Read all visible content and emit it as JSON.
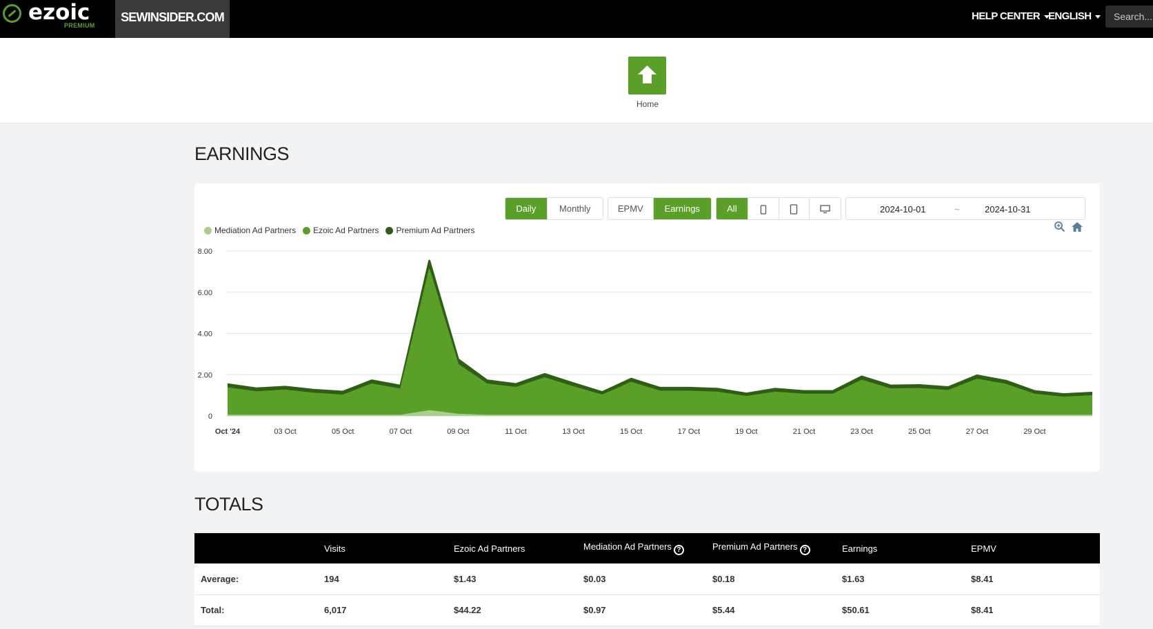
{
  "nav": {
    "logo_text": "ezoic",
    "logo_sub": "PREMIUM",
    "site": "SEWINSIDER.COM",
    "help_center": "HELP CENTER",
    "language": "ENGLISH",
    "search_placeholder": "Search..."
  },
  "header": {
    "home_label": "Home"
  },
  "earnings": {
    "title": "EARNINGS",
    "period_buttons": [
      "Daily",
      "Monthly"
    ],
    "active_period": "Daily",
    "metric_buttons": [
      "EPMV",
      "Earnings"
    ],
    "active_metric": "Earnings",
    "device_all_label": "All",
    "devices": [
      "mobile-icon",
      "tablet-icon",
      "desktop-icon"
    ],
    "date_start": "2024-10-01",
    "date_sep": "~",
    "date_end": "2024-10-31"
  },
  "colors": {
    "accent": "#5aa028",
    "mediation": "#a8d08d",
    "ezoic": "#5aa028",
    "premium": "#2f5f14"
  },
  "chart_data": {
    "type": "area",
    "stacked": true,
    "ylim": [
      0,
      8
    ],
    "yticks": [
      "0",
      "2.00",
      "4.00",
      "6.00",
      "8.00"
    ],
    "x_tick_labels": [
      "Oct '24",
      "03 Oct",
      "05 Oct",
      "07 Oct",
      "09 Oct",
      "11 Oct",
      "13 Oct",
      "15 Oct",
      "17 Oct",
      "19 Oct",
      "21 Oct",
      "23 Oct",
      "25 Oct",
      "27 Oct",
      "29 Oct"
    ],
    "x": [
      "2024-10-01",
      "2024-10-02",
      "2024-10-03",
      "2024-10-04",
      "2024-10-05",
      "2024-10-06",
      "2024-10-07",
      "2024-10-08",
      "2024-10-09",
      "2024-10-10",
      "2024-10-11",
      "2024-10-12",
      "2024-10-13",
      "2024-10-14",
      "2024-10-15",
      "2024-10-16",
      "2024-10-17",
      "2024-10-18",
      "2024-10-19",
      "2024-10-20",
      "2024-10-21",
      "2024-10-22",
      "2024-10-23",
      "2024-10-24",
      "2024-10-25",
      "2024-10-26",
      "2024-10-27",
      "2024-10-28",
      "2024-10-29",
      "2024-10-30",
      "2024-10-31"
    ],
    "series": [
      {
        "name": "Mediation Ad Partners",
        "values": [
          0.03,
          0.03,
          0.03,
          0.03,
          0.03,
          0.03,
          0.03,
          0.25,
          0.08,
          0.03,
          0.03,
          0.03,
          0.03,
          0.03,
          0.03,
          0.03,
          0.03,
          0.03,
          0.03,
          0.03,
          0.03,
          0.03,
          0.03,
          0.03,
          0.03,
          0.03,
          0.03,
          0.03,
          0.03,
          0.03,
          0.03
        ]
      },
      {
        "name": "Ezoic Ad Partners",
        "values": [
          1.33,
          1.14,
          1.22,
          1.07,
          0.98,
          1.52,
          1.27,
          6.86,
          2.42,
          1.52,
          1.35,
          1.82,
          1.38,
          0.98,
          1.6,
          1.17,
          1.17,
          1.12,
          0.91,
          1.12,
          1.02,
          1.02,
          1.7,
          1.28,
          1.3,
          1.2,
          1.75,
          1.5,
          1.02,
          0.88,
          0.95
        ]
      },
      {
        "name": "Premium Ad Partners",
        "values": [
          0.17,
          0.16,
          0.16,
          0.16,
          0.16,
          0.17,
          0.16,
          0.42,
          0.24,
          0.17,
          0.16,
          0.18,
          0.17,
          0.14,
          0.17,
          0.16,
          0.16,
          0.16,
          0.14,
          0.16,
          0.15,
          0.15,
          0.18,
          0.16,
          0.16,
          0.16,
          0.18,
          0.17,
          0.15,
          0.14,
          0.14
        ]
      }
    ]
  },
  "totals": {
    "title": "TOTALS",
    "columns": [
      "",
      "Visits",
      "Ezoic Ad Partners",
      "Mediation Ad Partners",
      "Premium Ad Partners",
      "Earnings",
      "EPMV"
    ],
    "rows": [
      {
        "label": "Average:",
        "values": [
          "194",
          "$1.43",
          "$0.03",
          "$0.18",
          "$1.63",
          "$8.41"
        ]
      },
      {
        "label": "Total:",
        "values": [
          "6,017",
          "$44.22",
          "$0.97",
          "$5.44",
          "$50.61",
          "$8.41"
        ]
      }
    ]
  }
}
